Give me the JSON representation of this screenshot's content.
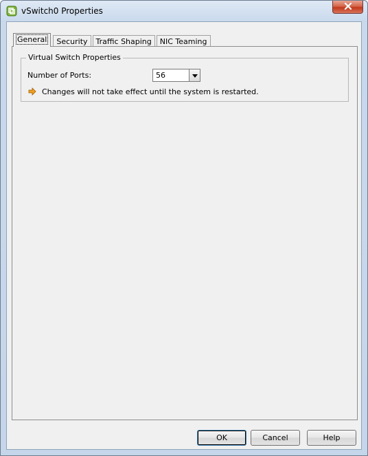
{
  "window": {
    "title": "vSwitch0 Properties",
    "icon": "vmware-icon",
    "close_icon": "close-icon"
  },
  "tabs": [
    {
      "label": "General",
      "active": true
    },
    {
      "label": "Security",
      "active": false
    },
    {
      "label": "Traffic Shaping",
      "active": false
    },
    {
      "label": "NIC Teaming",
      "active": false
    }
  ],
  "general": {
    "group_title": "Virtual Switch Properties",
    "ports_label": "Number of Ports:",
    "ports_value": "56",
    "warning_icon": "warning-arrow-icon",
    "warning_text": "Changes will not take effect until the system is restarted."
  },
  "buttons": {
    "ok": "OK",
    "cancel": "Cancel",
    "help": "Help"
  },
  "colors": {
    "titlebar": "#c9d9ec",
    "close_button": "#c2391c",
    "dialog_bg": "#f0f0f0",
    "warning_icon": "#e08a00"
  }
}
